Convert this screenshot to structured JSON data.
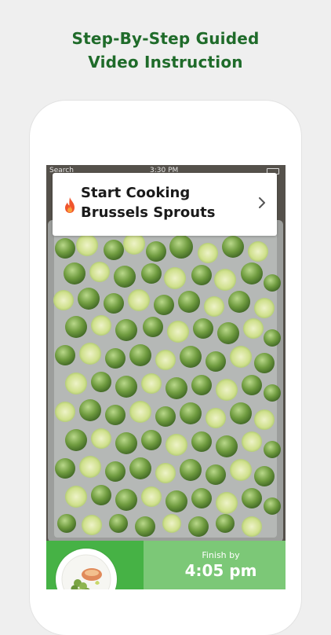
{
  "headline": {
    "line1": "Step-By-Step Guided",
    "line2": "Video Instruction"
  },
  "status_bar": {
    "back_label": "Search",
    "time": "3:30 PM"
  },
  "recipe_card": {
    "line1": "Start Cooking",
    "line2": "Brussels Sprouts",
    "icon": "flame-icon",
    "chevron": "chevron-right-icon"
  },
  "timer": {
    "label": "Finish by",
    "time": "4:05 pm"
  },
  "colors": {
    "headline_green": "#1f6b2a",
    "timer_dark": "#46b245",
    "timer_light": "#7cc877",
    "flame": "#f0552d"
  }
}
